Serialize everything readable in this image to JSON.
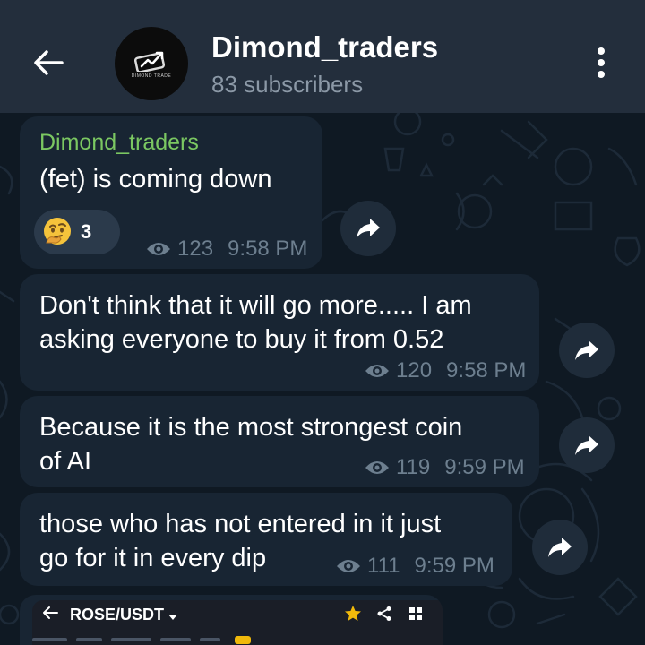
{
  "header": {
    "title": "Dimond_traders",
    "subscribers": "83 subscribers",
    "avatar_text": "DIMOND TRADE"
  },
  "messages": [
    {
      "author": "Dimond_traders",
      "text": "(fet) is coming down",
      "reaction_emoji": "thinking-face",
      "reaction_count": "3",
      "views": "123",
      "time": "9:58 PM"
    },
    {
      "text_line1": "Don't think that it will go more..... I am",
      "text_line2": "asking everyone to buy it from 0.52",
      "views": "120",
      "time": "9:58 PM"
    },
    {
      "text_line1": "Because it is the most strongest coin",
      "text_line2": "of AI",
      "views": "119",
      "time": "9:59 PM"
    },
    {
      "text_line1": "those who has not entered in it just",
      "text_line2": "go for it in every dip",
      "views": "111",
      "time": "9:59 PM"
    }
  ],
  "preview": {
    "pair": "ROSE/USDT"
  },
  "colors": {
    "header_bg": "#232e3c",
    "chat_bg": "#0e1621",
    "bubble_bg": "#182533",
    "author": "#7bc862",
    "meta": "#6d7f8f",
    "star": "#f0b90b"
  }
}
